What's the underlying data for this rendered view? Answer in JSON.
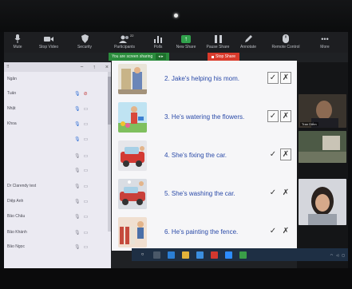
{
  "toolbar": {
    "items": [
      {
        "label": "Mute",
        "icon": "mic-icon"
      },
      {
        "label": "Stop Video",
        "icon": "video-camera-icon"
      },
      {
        "label": "Security",
        "icon": "shield-icon"
      },
      {
        "label": "Participants",
        "icon": "participants-icon",
        "count": "22"
      },
      {
        "label": "Polls",
        "icon": "poll-bars-icon"
      },
      {
        "label": "New Share",
        "icon": "share-screen-icon"
      },
      {
        "label": "Pause Share",
        "icon": "pause-icon"
      },
      {
        "label": "Annotate",
        "icon": "pencil-icon"
      },
      {
        "label": "Remote Control",
        "icon": "mouse-icon"
      },
      {
        "label": "More",
        "icon": "more-dots-icon"
      }
    ]
  },
  "share_banner": {
    "text": "You are screen sharing",
    "stop_label": "Stop Share",
    "color": "#2b8c3d",
    "stop_color": "#d93a2b"
  },
  "participants_panel": {
    "rows": [
      {
        "name": "Ngân"
      },
      {
        "name": "Tuấn"
      },
      {
        "name": "Nhật"
      },
      {
        "name": "Khoa"
      },
      {
        "name": ""
      },
      {
        "name": ""
      },
      {
        "name": ""
      },
      {
        "name": "Dr Clarendy test"
      },
      {
        "name": "Diệp Anh"
      },
      {
        "name": "Bảo Châu"
      },
      {
        "name": "Bảo Khánh"
      },
      {
        "name": "Bảo Ngọc"
      }
    ]
  },
  "worksheet": {
    "exercises": [
      {
        "text": "2. Jake's helping his mom.",
        "check": "✓",
        "cross": "✗",
        "boxed": true
      },
      {
        "text": "3. He's watering the flowers.",
        "check": "✓",
        "cross": "✗",
        "boxed": true
      },
      {
        "text": "4. She's fixing the car.",
        "check": "✓",
        "cross": "✗",
        "boxed": false
      },
      {
        "text": "5. She's washing the car.",
        "check": "✓",
        "cross": "✗",
        "boxed": false
      },
      {
        "text": "6. He's painting the fence.",
        "check": "✓",
        "cross": "✗",
        "boxed": false
      }
    ]
  },
  "video_tiles": [
    {
      "name": "Tran Diễm"
    },
    {
      "name": ""
    },
    {
      "name": ""
    }
  ]
}
